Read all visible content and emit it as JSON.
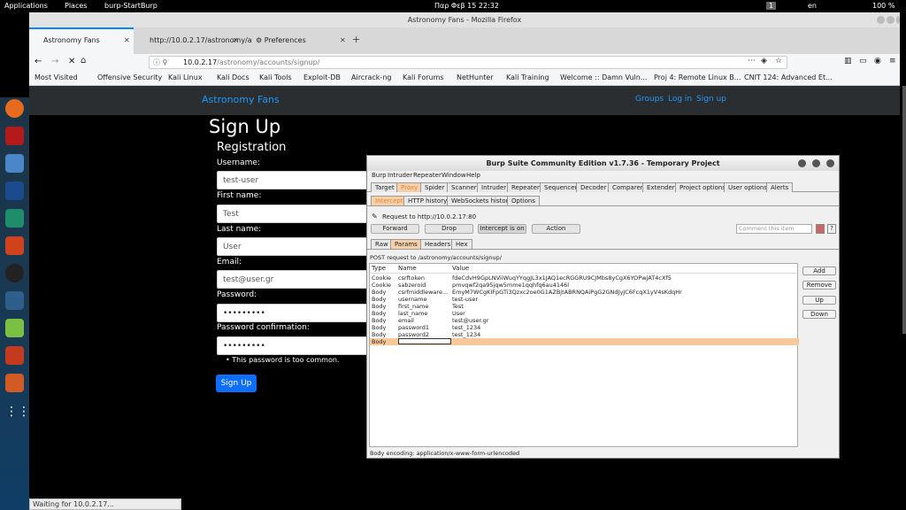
{
  "topbar": {
    "applications": "Applications",
    "places": "Places",
    "app": "burp-StartBurp",
    "clock": "Παρ Φεβ 15  22:32",
    "workspace": "1",
    "lang": "en",
    "battery": "100 %"
  },
  "window": {
    "title": "Astronomy Fans - Mozilla Firefox"
  },
  "tabs": [
    {
      "label": "Astronomy Fans"
    },
    {
      "label": "http://10.0.2.17/astronomy/a"
    },
    {
      "label": "Preferences"
    }
  ],
  "url": {
    "host": "10.0.2.17",
    "path": "/astronomy/accounts/signup/"
  },
  "bookmarks": [
    "Most Visited",
    "Offensive Security",
    "Kali Linux",
    "Kali Docs",
    "Kali Tools",
    "Exploit-DB",
    "Aircrack-ng",
    "Kali Forums",
    "NetHunter",
    "Kali Training",
    "Welcome :: Damn Vuln...",
    "Proj 4: Remote Linux B...",
    "CNIT 124: Advanced Et..."
  ],
  "site": {
    "brand": "Astronomy Fans",
    "links": {
      "groups": "Groups",
      "login": "Log in",
      "signup": "Sign up"
    },
    "heading": "Sign Up",
    "subheading": "Registration",
    "fields": {
      "username": {
        "label": "Username:",
        "value": "test-user"
      },
      "first_name": {
        "label": "First name:",
        "value": "Test"
      },
      "last_name": {
        "label": "Last name:",
        "value": "User"
      },
      "email": {
        "label": "Email:",
        "value": "test@user.gr"
      },
      "password": {
        "label": "Password:",
        "value": "•••••••••"
      },
      "password_confirm": {
        "label": "Password confirmation:",
        "value": "•••••••••"
      }
    },
    "error": "This password is too common.",
    "submit": "Sign Up"
  },
  "status": "Waiting for 10.0.2.17...",
  "burp": {
    "title": "Burp Suite Community Edition v1.7.36 - Temporary Project",
    "menu": [
      "Burp",
      "Intruder",
      "Repeater",
      "Window",
      "Help"
    ],
    "tabs": [
      "Target",
      "Proxy",
      "Spider",
      "Scanner",
      "Intruder",
      "Repeater",
      "Sequencer",
      "Decoder",
      "Comparer",
      "Extender",
      "Project options",
      "User options",
      "Alerts"
    ],
    "subtabs": [
      "Intercept",
      "HTTP history",
      "WebSockets history",
      "Options"
    ],
    "request_label": "Request to http://10.0.2.17:80",
    "buttons": {
      "forward": "Forward",
      "drop": "Drop",
      "intercept": "Intercept is on",
      "action": "Action"
    },
    "comment_placeholder": "Comment this item",
    "viewtabs": [
      "Raw",
      "Params",
      "Headers",
      "Hex"
    ],
    "post_line": "POST request to /astronomy/accounts/signup/",
    "columns": {
      "type": "Type",
      "name": "Name",
      "value": "Value"
    },
    "rows": [
      {
        "type": "Cookie",
        "name": "csrftoken",
        "value": "fdeCdvH9GpLNViiWuqYYqgJL3x1JAQ1ecRGGRU9CJMbs8yCgX6YOPwjAT4cXf5"
      },
      {
        "type": "Cookie",
        "name": "sabzeroid",
        "value": "pmvqwf2qa95jqw5mme1qqhfq6au4146l"
      },
      {
        "type": "Body",
        "name": "csrfmiddleware...",
        "value": "EmyM7WCgKIFpGTi3Qzxc2oe0G1AZBjtABRNQAiPgG2GNdJyJC6FcqX1yV4sKdqHr"
      },
      {
        "type": "Body",
        "name": "username",
        "value": "test-user"
      },
      {
        "type": "Body",
        "name": "first_name",
        "value": "Test"
      },
      {
        "type": "Body",
        "name": "last_name",
        "value": "User"
      },
      {
        "type": "Body",
        "name": "email",
        "value": "test@user.gr"
      },
      {
        "type": "Body",
        "name": "password1",
        "value": "test_1234"
      },
      {
        "type": "Body",
        "name": "password2",
        "value": "test_1234"
      },
      {
        "type": "Body",
        "name": "",
        "value": ""
      }
    ],
    "side_buttons": {
      "add": "Add",
      "remove": "Remove",
      "up": "Up",
      "down": "Down"
    },
    "encoding": "Body encoding:  application/x-www-form-urlencoded"
  }
}
